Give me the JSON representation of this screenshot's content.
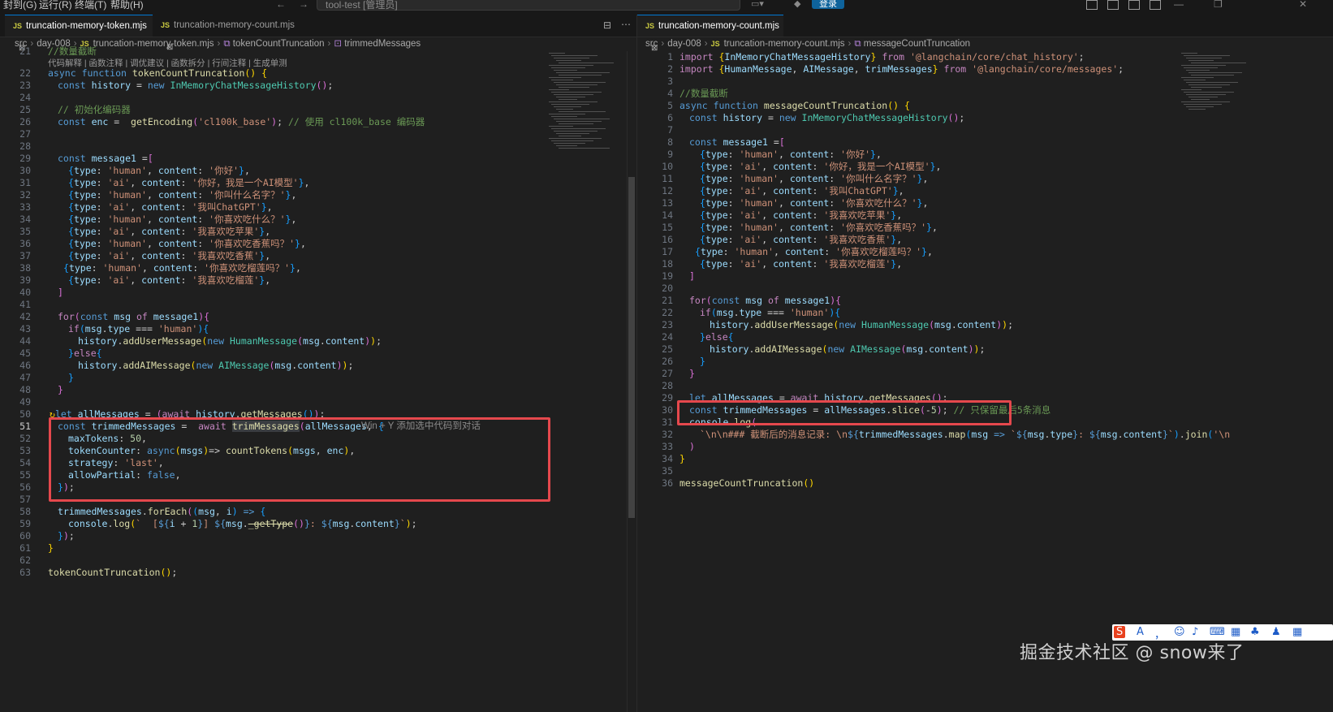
{
  "titlebar": {
    "menus": [
      "封到(G)",
      "运行(R)",
      "终端(T)",
      "帮助(H)"
    ],
    "command_center": "tool-test [管理员]",
    "login": "登录"
  },
  "left": {
    "tabs": [
      {
        "label": "truncation-memory-token.mjs",
        "active": true
      },
      {
        "label": "truncation-memory-count.mjs",
        "active": false
      }
    ],
    "breadcrumb": [
      "src",
      "day-008",
      "truncation-memory-token.mjs",
      "tokenCountTruncation",
      "trimmedMessages"
    ],
    "codelens": "代码解释 | 函数注释 | 调优建议 | 函数拆分 | 行间注释 | 生成单测",
    "top_partial_comment": "//数量截断",
    "inline_hint": "Win + Y 添加选中代码到对话",
    "line_numbers": [
      "21",
      "22",
      "23",
      "24",
      "25",
      "26",
      "27",
      "28",
      "29",
      "30",
      "31",
      "32",
      "33",
      "34",
      "35",
      "36",
      "37",
      "38",
      "39",
      "40",
      "41",
      "42",
      "43",
      "44",
      "45",
      "46",
      "47",
      "48",
      "49",
      "50",
      "51",
      "52",
      "53",
      "54",
      "55",
      "56",
      "57",
      "58",
      "59",
      "60",
      "61",
      "62",
      "63"
    ]
  },
  "right": {
    "tabs": [
      {
        "label": "truncation-memory-count.mjs",
        "active": true
      }
    ],
    "breadcrumb": [
      "src",
      "day-008",
      "truncation-memory-count.mjs",
      "messageCountTruncation"
    ],
    "line_numbers": [
      "1",
      "2",
      "3",
      "4",
      "5",
      "6",
      "7",
      "8",
      "9",
      "10",
      "11",
      "12",
      "13",
      "14",
      "15",
      "16",
      "17",
      "18",
      "19",
      "20",
      "21",
      "22",
      "23",
      "24",
      "25",
      "26",
      "27",
      "28",
      "29",
      "30",
      "31",
      "32",
      "33",
      "34",
      "35",
      "36"
    ]
  },
  "ime_toolbar": "S A ， ☺ 🎙 ⌨ ▦ 👕 ▦",
  "watermark": "掘金技术社区 @ snow来了"
}
